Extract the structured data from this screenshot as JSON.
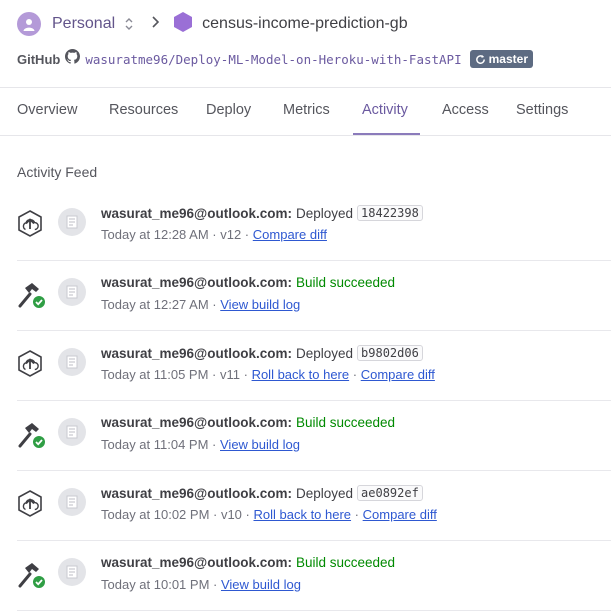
{
  "header": {
    "account": "Personal",
    "app_name": "census-income-prediction-gb",
    "source_label": "GitHub",
    "repo": "wasuratme96/Deploy-ML-Model-on-Heroku-with-FastAPI",
    "branch": "master"
  },
  "tabs": [
    {
      "label": "Overview"
    },
    {
      "label": "Resources"
    },
    {
      "label": "Deploy"
    },
    {
      "label": "Metrics"
    },
    {
      "label": "Activity"
    },
    {
      "label": "Access"
    },
    {
      "label": "Settings"
    }
  ],
  "active_tab": "Activity",
  "feed": {
    "title": "Activity Feed",
    "items": [
      {
        "kind": "deploy",
        "email": "wasurat_me96@outlook.com:",
        "action": "Deployed",
        "sha": "18422398",
        "time": "Today at 12:28 AM · v12 ·",
        "link1": "Compare diff",
        "sep": "",
        "link2": ""
      },
      {
        "kind": "build",
        "email": "wasurat_me96@outlook.com:",
        "action": "Build succeeded",
        "sha": "",
        "time": "Today at 12:27 AM ·",
        "link1": "View build log",
        "sep": "",
        "link2": ""
      },
      {
        "kind": "deploy",
        "email": "wasurat_me96@outlook.com:",
        "action": "Deployed",
        "sha": "b9802d06",
        "time": "Today at 11:05 PM · v11 ·",
        "link1": "Roll back to here",
        "sep": "·",
        "link2": "Compare diff"
      },
      {
        "kind": "build",
        "email": "wasurat_me96@outlook.com:",
        "action": "Build succeeded",
        "sha": "",
        "time": "Today at 11:04 PM ·",
        "link1": "View build log",
        "sep": "",
        "link2": ""
      },
      {
        "kind": "deploy",
        "email": "wasurat_me96@outlook.com:",
        "action": "Deployed",
        "sha": "ae0892ef",
        "time": "Today at 10:02 PM · v10 ·",
        "link1": "Roll back to here",
        "sep": "·",
        "link2": "Compare diff"
      },
      {
        "kind": "build",
        "email": "wasurat_me96@outlook.com:",
        "action": "Build succeeded",
        "sha": "",
        "time": "Today at 10:01 PM ·",
        "link1": "View build log",
        "sep": "",
        "link2": ""
      }
    ]
  },
  "colors": {
    "accent": "#6b5aa0",
    "success": "#008a00",
    "link": "#2e58d1",
    "branch_badge": "#5d6b82"
  }
}
